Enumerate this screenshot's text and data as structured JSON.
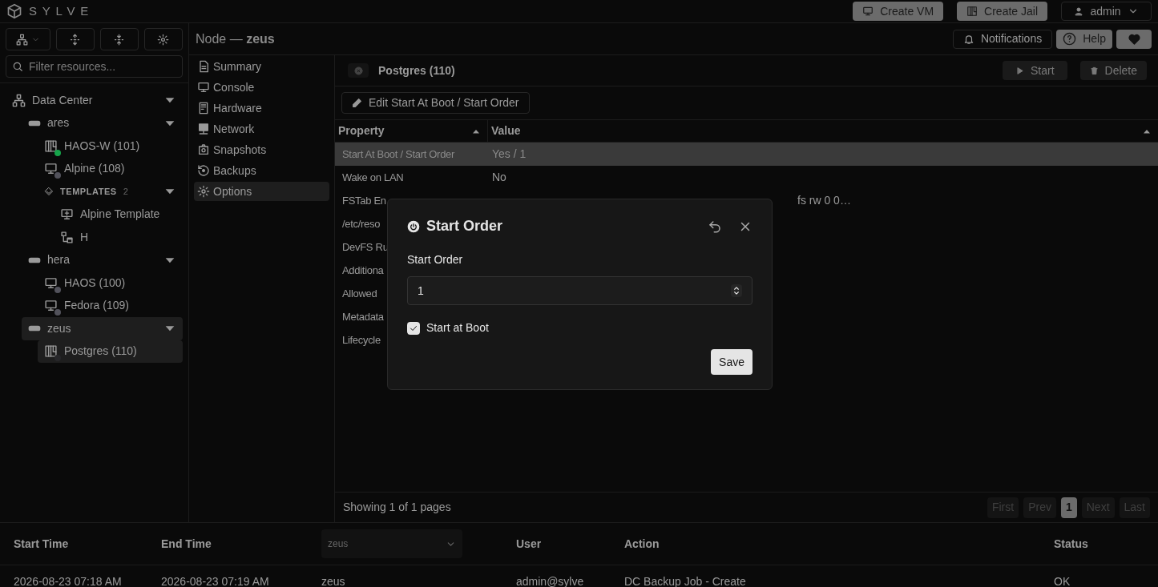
{
  "app": {
    "logo_text": "SYLVE"
  },
  "top_actions": [
    {
      "kind": "vm",
      "label": "Create VM"
    },
    {
      "kind": "jail",
      "label": "Create Jail"
    }
  ],
  "user_menu": {
    "label": "admin"
  },
  "sidebar": {
    "filter_placeholder": "Filter resources...",
    "tree": [
      {
        "kind": "datacenter",
        "label": "Data Center",
        "expanded": true,
        "selected": false,
        "children": [
          {
            "kind": "node",
            "label": "ares",
            "expanded": true,
            "selected": false,
            "children": [
              {
                "kind": "jail",
                "label": "HAOS-W (101)",
                "color": "#16a34a",
                "selected": false
              },
              {
                "kind": "vm",
                "label": "Alpine (108)",
                "color": "#52525b",
                "selected": false
              },
              {
                "kind": "templates",
                "label": "TEMPLATES",
                "count": "2",
                "expanded": true,
                "selected": false,
                "children": [
                  {
                    "kind": "vm-template",
                    "label": "Alpine Template",
                    "selected": false
                  },
                  {
                    "kind": "jail-template",
                    "label": "H",
                    "selected": false
                  }
                ]
              }
            ]
          },
          {
            "kind": "node",
            "label": "hera",
            "expanded": true,
            "selected": false,
            "children": [
              {
                "kind": "vm",
                "label": "HAOS (100)",
                "color": "#52525b",
                "selected": false
              },
              {
                "kind": "vm",
                "label": "Fedora (109)",
                "color": "#52525b",
                "selected": false
              }
            ]
          },
          {
            "kind": "node",
            "label": "zeus",
            "expanded": true,
            "selected": true,
            "children": [
              {
                "kind": "jail",
                "label": "Postgres (110)",
                "color": "#27272a",
                "selected": true
              }
            ]
          }
        ]
      }
    ]
  },
  "breadcrumb": {
    "prefix": "Node —",
    "name": "zeus"
  },
  "header_actions": [
    {
      "kind": "notifications",
      "label": "Notifications"
    },
    {
      "kind": "help",
      "label": "Help"
    },
    {
      "kind": "heart"
    }
  ],
  "nav": [
    {
      "kind": "summary",
      "label": "Summary",
      "selected": false
    },
    {
      "kind": "console",
      "label": "Console",
      "selected": false
    },
    {
      "kind": "hardware",
      "label": "Hardware",
      "selected": false
    },
    {
      "kind": "network",
      "label": "Network",
      "selected": false
    },
    {
      "kind": "snapshots",
      "label": "Snapshots",
      "selected": false
    },
    {
      "kind": "backups",
      "label": "Backups",
      "selected": false
    },
    {
      "kind": "options",
      "label": "Options",
      "selected": true
    }
  ],
  "panel": {
    "title": "Postgres (110)",
    "actions": [
      {
        "kind": "start",
        "label": "Start"
      },
      {
        "kind": "delete",
        "label": "Delete"
      }
    ],
    "edit_button": "Edit Start At Boot / Start Order",
    "table": {
      "columns": [
        "Property",
        "Value"
      ],
      "rows": [
        {
          "property": "Start At Boot / Start Order",
          "value": "Yes / 1",
          "selected": true
        },
        {
          "property": "Wake on LAN",
          "value": "No",
          "selected": false
        },
        {
          "property": "FSTab En",
          "value": "fs rw 0 0…",
          "kind": "covered",
          "selected": false
        },
        {
          "property": "/etc/reso",
          "selected": false
        },
        {
          "property": "DevFS Ru",
          "selected": false
        },
        {
          "property": "Additiona",
          "selected": false
        },
        {
          "property": "Allowed",
          "selected": false
        },
        {
          "property": "Metadata",
          "selected": false
        },
        {
          "property": "Lifecycle",
          "selected": false
        }
      ]
    },
    "footer": {
      "summary": "Showing 1 of 1 pages",
      "pager": [
        {
          "label": "First",
          "selected": false
        },
        {
          "label": "Prev",
          "selected": false
        },
        {
          "label": "1",
          "selected": true
        },
        {
          "label": "Next",
          "selected": false
        },
        {
          "label": "Last",
          "selected": false
        }
      ]
    }
  },
  "dialog": {
    "title": "Start Order",
    "field_label": "Start Order",
    "field_value": "1",
    "checkbox_label": "Start at Boot",
    "checked": true,
    "save": "Save"
  },
  "tasks": {
    "columns": [
      "Start Time",
      "End Time",
      "zeus",
      "User",
      "Action",
      "Status"
    ],
    "rows": [
      [
        "2026-08-23 07:18 AM",
        "2026-08-23 07:19 AM",
        "zeus",
        "admin@sylve",
        "DC Backup Job - Create",
        "OK"
      ]
    ]
  }
}
